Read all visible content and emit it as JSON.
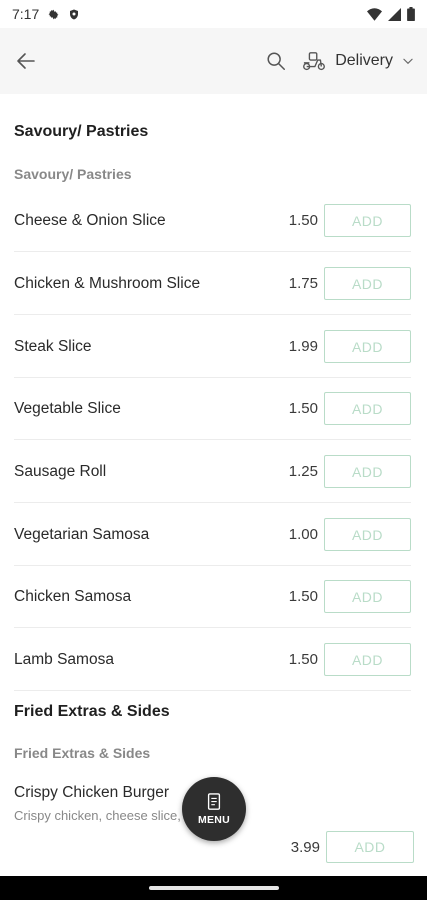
{
  "status_bar": {
    "time": "7:17"
  },
  "app_bar": {
    "delivery_label": "Delivery"
  },
  "sections": [
    {
      "title": "Savoury/ Pastries",
      "subtitle": "Savoury/ Pastries",
      "items": [
        {
          "name": "Cheese & Onion Slice",
          "price": "1.50",
          "add": "ADD"
        },
        {
          "name": "Chicken & Mushroom Slice",
          "price": "1.75",
          "add": "ADD"
        },
        {
          "name": "Steak Slice",
          "price": "1.99",
          "add": "ADD"
        },
        {
          "name": "Vegetable Slice",
          "price": "1.50",
          "add": "ADD"
        },
        {
          "name": "Sausage Roll",
          "price": "1.25",
          "add": "ADD"
        },
        {
          "name": "Vegetarian Samosa",
          "price": "1.00",
          "add": "ADD"
        },
        {
          "name": "Chicken Samosa",
          "price": "1.50",
          "add": "ADD"
        },
        {
          "name": "Lamb Samosa",
          "price": "1.50",
          "add": "ADD"
        }
      ]
    },
    {
      "title": "Fried Extras & Sides",
      "subtitle": "Fried Extras & Sides",
      "items": [
        {
          "name": "Crispy Chicken Burger",
          "description": "Crispy chicken, cheese slice, mayo",
          "price": "3.99",
          "add": "ADD"
        }
      ]
    }
  ],
  "fab": {
    "label": "MENU"
  },
  "colors": {
    "accent": "#b9dcc8",
    "fab": "#2e2e2e",
    "app_bar": "#f6f6f6"
  },
  "icons": {
    "status": [
      "gear-icon",
      "shield-icon",
      "wifi-icon",
      "signal-icon",
      "battery-icon"
    ],
    "app_bar": [
      "back-arrow-icon",
      "search-icon",
      "delivery-scooter-icon",
      "chevron-down-icon"
    ],
    "fab": "menu-document-icon"
  }
}
